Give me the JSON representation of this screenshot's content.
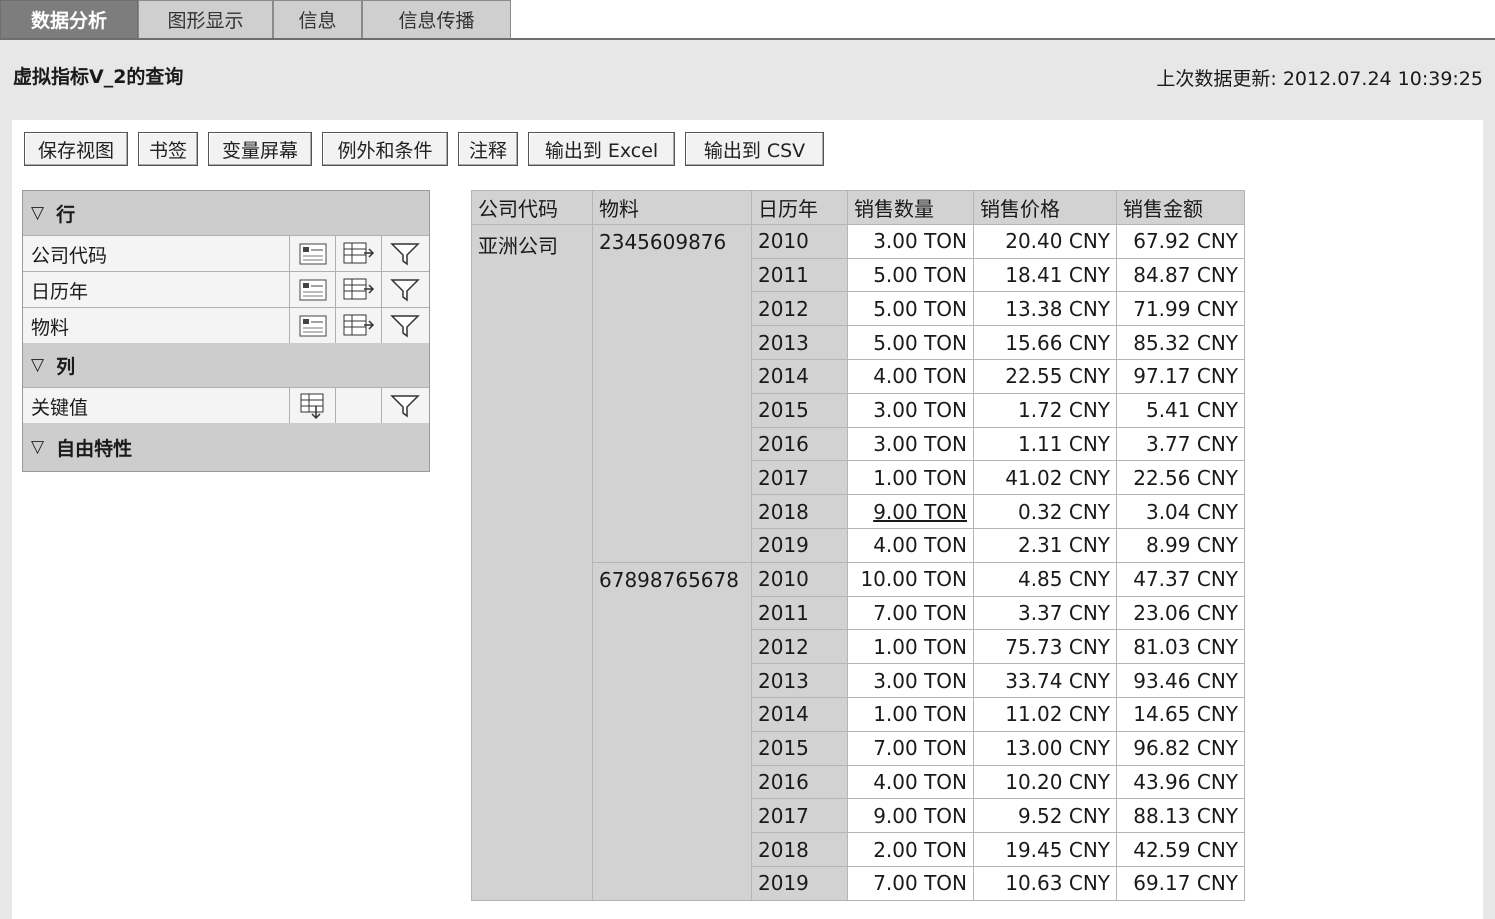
{
  "tabs": [
    {
      "label": "数据分析",
      "active": true
    },
    {
      "label": "图形显示",
      "active": false
    },
    {
      "label": "信息",
      "active": false
    },
    {
      "label": "信息传播",
      "active": false
    }
  ],
  "header": {
    "title": "虚拟指标V_2的查询",
    "last_update_label": "上次数据更新:",
    "last_update_value": "2012.07.24 10:39:25"
  },
  "toolbar": {
    "save_view": "保存视图",
    "bookmark": "书签",
    "variable_screen": "变量屏幕",
    "exceptions_conditions": "例外和条件",
    "comments": "注释",
    "export_excel": "输出到 Excel",
    "export_csv": "输出到 CSV"
  },
  "nav": {
    "rows_title": "行",
    "row_items": [
      "公司代码",
      "日历年",
      "物料"
    ],
    "columns_title": "列",
    "column_items": [
      "关键值"
    ],
    "free_title": "自由特性"
  },
  "table": {
    "headers": [
      "公司代码",
      "物料",
      "日历年",
      "销售数量",
      "销售价格",
      "销售金额"
    ],
    "company": "亚洲公司",
    "groups": [
      {
        "material": "2345609876",
        "rows": [
          {
            "year": "2010",
            "qty": "3.00 TON",
            "price": "20.40 CNY",
            "amount": "67.92 CNY"
          },
          {
            "year": "2011",
            "qty": "5.00 TON",
            "price": "18.41 CNY",
            "amount": "84.87 CNY"
          },
          {
            "year": "2012",
            "qty": "5.00 TON",
            "price": "13.38 CNY",
            "amount": "71.99 CNY"
          },
          {
            "year": "2013",
            "qty": "5.00 TON",
            "price": "15.66 CNY",
            "amount": "85.32 CNY"
          },
          {
            "year": "2014",
            "qty": "4.00 TON",
            "price": "22.55 CNY",
            "amount": "97.17 CNY"
          },
          {
            "year": "2015",
            "qty": "3.00 TON",
            "price": "1.72 CNY",
            "amount": "5.41 CNY"
          },
          {
            "year": "2016",
            "qty": "3.00 TON",
            "price": "1.11 CNY",
            "amount": "3.77 CNY"
          },
          {
            "year": "2017",
            "qty": "1.00 TON",
            "price": "41.02 CNY",
            "amount": "22.56 CNY"
          },
          {
            "year": "2018",
            "qty": "9.00 TON",
            "price": "0.32 CNY",
            "amount": "3.04 CNY"
          },
          {
            "year": "2019",
            "qty": "4.00 TON",
            "price": "2.31 CNY",
            "amount": "8.99 CNY"
          }
        ]
      },
      {
        "material": "67898765678",
        "rows": [
          {
            "year": "2010",
            "qty": "10.00 TON",
            "price": "4.85 CNY",
            "amount": "47.37 CNY"
          },
          {
            "year": "2011",
            "qty": "7.00 TON",
            "price": "3.37 CNY",
            "amount": "23.06 CNY"
          },
          {
            "year": "2012",
            "qty": "1.00 TON",
            "price": "75.73 CNY",
            "amount": "81.03 CNY"
          },
          {
            "year": "2013",
            "qty": "3.00 TON",
            "price": "33.74 CNY",
            "amount": "93.46 CNY"
          },
          {
            "year": "2014",
            "qty": "1.00 TON",
            "price": "11.02 CNY",
            "amount": "14.65 CNY"
          },
          {
            "year": "2015",
            "qty": "7.00 TON",
            "price": "13.00 CNY",
            "amount": "96.82 CNY"
          },
          {
            "year": "2016",
            "qty": "4.00 TON",
            "price": "10.20 CNY",
            "amount": "43.96 CNY"
          },
          {
            "year": "2017",
            "qty": "9.00 TON",
            "price": "9.52 CNY",
            "amount": "88.13 CNY"
          },
          {
            "year": "2018",
            "qty": "2.00 TON",
            "price": "19.45 CNY",
            "amount": "42.59 CNY"
          },
          {
            "year": "2019",
            "qty": "7.00 TON",
            "price": "10.63 CNY",
            "amount": "69.17 CNY"
          }
        ]
      }
    ]
  }
}
